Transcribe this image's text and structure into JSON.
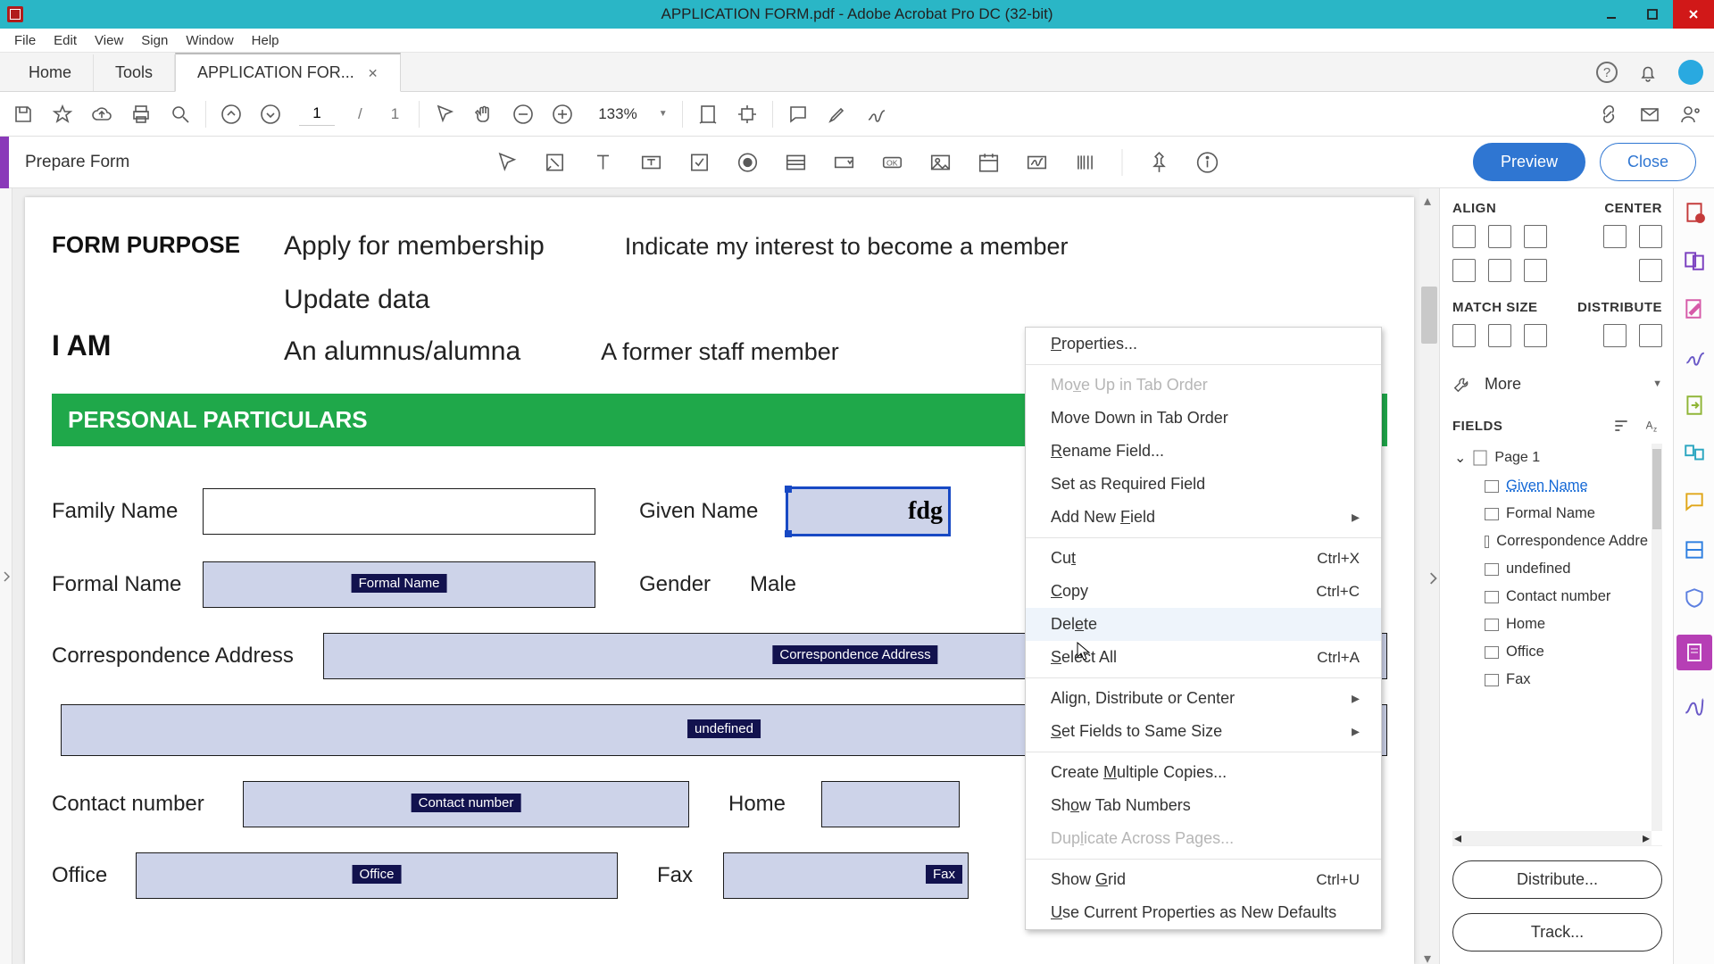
{
  "titlebar": {
    "title": "APPLICATION FORM.pdf - Adobe Acrobat Pro DC (32-bit)"
  },
  "menubar": [
    "File",
    "Edit",
    "View",
    "Sign",
    "Window",
    "Help"
  ],
  "tabs": {
    "home": "Home",
    "tools": "Tools",
    "doc": "APPLICATION FOR..."
  },
  "maintb": {
    "page_current": "1",
    "page_total": "1",
    "zoom": "133%"
  },
  "pfbar": {
    "label": "Prepare Form",
    "preview": "Preview",
    "close": "Close"
  },
  "doc": {
    "form_purpose_lbl": "FORM PURPOSE",
    "apply": "Apply for membership",
    "indicate": "Indicate my interest to become a member",
    "update": "Update data",
    "iam_lbl": "I AM",
    "alum": "An alumnus/alumna",
    "former": "A former staff member",
    "section": "PERSONAL PARTICULARS",
    "labels": {
      "family": "Family Name",
      "given": "Given Name",
      "formal": "Formal Name",
      "gender": "Gender",
      "male": "Male",
      "corr": "Correspondence Address",
      "undef": "undefined",
      "contact": "Contact number",
      "home": "Home",
      "office": "Office",
      "fax": "Fax"
    },
    "field_tags": {
      "formal": "Formal Name",
      "corr": "Correspondence Address",
      "undef": "undefined",
      "contact": "Contact number",
      "office": "Office",
      "fax": "Fax",
      "given_stub": "fdg"
    }
  },
  "ctx": {
    "properties": "Properties...",
    "moveup": "Move Up in Tab Order",
    "movedown": "Move Down in Tab Order",
    "rename": "Rename Field...",
    "required": "Set as Required Field",
    "addnew": "Add New Field",
    "cut": "Cut",
    "cut_k": "Ctrl+X",
    "copy": "Copy",
    "copy_k": "Ctrl+C",
    "delete": "Delete",
    "selectall": "Select All",
    "selectall_k": "Ctrl+A",
    "align": "Align, Distribute or Center",
    "samesize": "Set Fields to Same Size",
    "multi": "Create Multiple Copies...",
    "tabnums": "Show Tab Numbers",
    "dup": "Duplicate Across Pages...",
    "grid": "Show Grid",
    "grid_k": "Ctrl+U",
    "defaults": "Use Current Properties as New Defaults"
  },
  "rpanel": {
    "align": "ALIGN",
    "center": "CENTER",
    "match": "MATCH SIZE",
    "dist": "DISTRIBUTE",
    "more": "More",
    "fields": "FIELDS",
    "page1": "Page 1",
    "list": [
      "Given Name",
      "Formal Name",
      "Correspondence Addre",
      "undefined",
      "Contact number",
      "Home",
      "Office",
      "Fax"
    ],
    "distribute_btn": "Distribute...",
    "track_btn": "Track..."
  }
}
